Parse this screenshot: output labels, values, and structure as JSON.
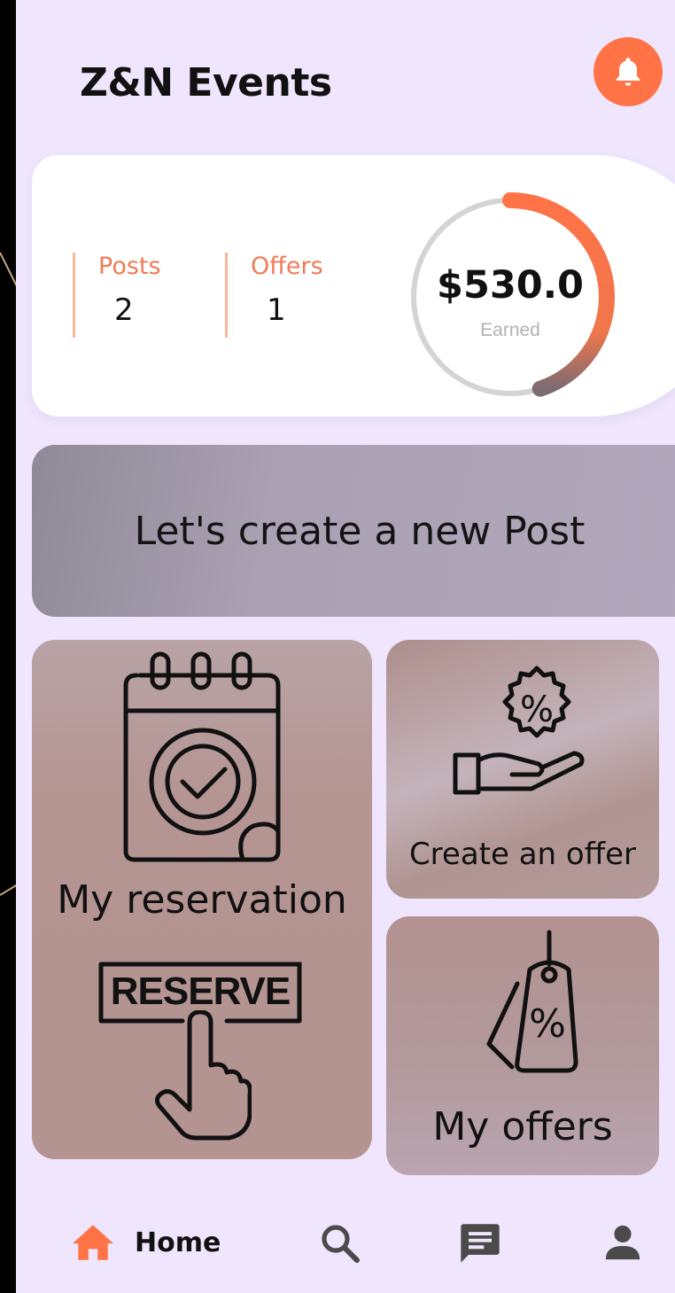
{
  "app": {
    "title": "Z&N Events"
  },
  "header": {
    "notification_icon": "bell-icon"
  },
  "stats": {
    "posts_label": "Posts",
    "posts_value": "2",
    "offers_label": "Offers",
    "offers_value": "1",
    "earned_amount": "$530.0",
    "earned_label": "Earned",
    "earned_progress": 0.45
  },
  "banner": {
    "label": "Let's create a new Post"
  },
  "tiles": {
    "reservation_label": "My reservation",
    "reserve_sign_text": "RESERVE",
    "create_offer_label": "Create an offer",
    "my_offers_label": "My offers",
    "offer_badge_symbol": "%",
    "tag_symbol": "%"
  },
  "nav": {
    "home_label": "Home",
    "icons": [
      "home-icon",
      "search-icon",
      "chat-icon",
      "profile-icon"
    ]
  },
  "colors": {
    "accent": "#ff7347",
    "background": "#efe5fd",
    "stat_label": "#f07b57"
  }
}
